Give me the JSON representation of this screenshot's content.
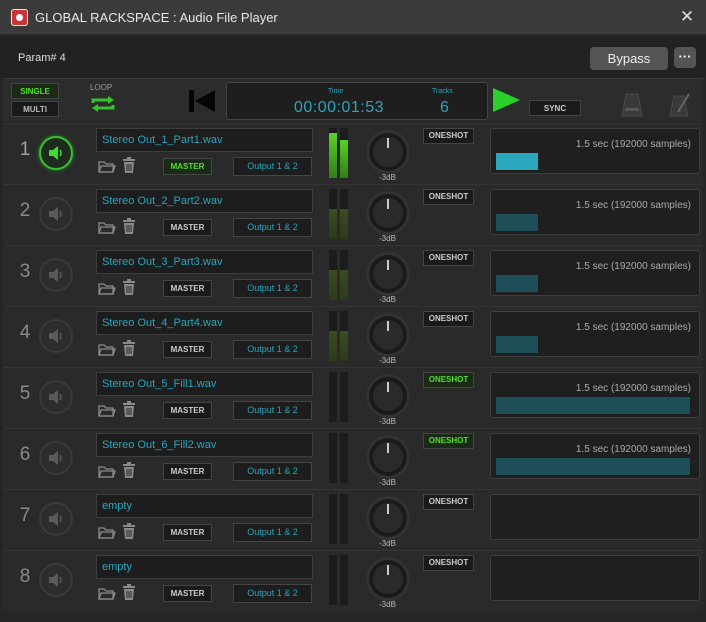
{
  "window": {
    "title": "GLOBAL RACKSPACE : Audio File Player",
    "close_glyph": "✕"
  },
  "topbar": {
    "param": "Param# 4",
    "bypass": "Bypass",
    "more": "···"
  },
  "transport": {
    "single": "SINGLE",
    "multi": "MULTI",
    "loop": "LOOP",
    "time_label": "Time",
    "time": "00:00:01:53",
    "tracks_label": "Tracks",
    "tracks": "6",
    "sync": "SYNC"
  },
  "colors": {
    "accent_teal": "#29a5bd",
    "active_green": "#4ee02b"
  },
  "icons": [
    "app-icon",
    "close-icon",
    "loop-icon",
    "previous-icon",
    "play-icon",
    "metronome-icon",
    "speaker-icon",
    "folder-icon",
    "trash-icon"
  ],
  "rows": [
    {
      "num": "1",
      "file": "Stereo Out_1_Part1.wav",
      "master": "MASTER",
      "output": "Output 1 & 2",
      "db": "-3dB",
      "oneshot": "ONESHOT",
      "wave_text": "1.5 sec (192000 samples)"
    },
    {
      "num": "2",
      "file": "Stereo Out_2_Part2.wav",
      "master": "MASTER",
      "output": "Output 1 & 2",
      "db": "-3dB",
      "oneshot": "ONESHOT",
      "wave_text": "1.5 sec (192000 samples)"
    },
    {
      "num": "3",
      "file": "Stereo Out_3_Part3.wav",
      "master": "MASTER",
      "output": "Output 1 & 2",
      "db": "-3dB",
      "oneshot": "ONESHOT",
      "wave_text": "1.5 sec (192000 samples)"
    },
    {
      "num": "4",
      "file": "Stereo Out_4_Part4.wav",
      "master": "MASTER",
      "output": "Output 1 & 2",
      "db": "-3dB",
      "oneshot": "ONESHOT",
      "wave_text": "1.5 sec (192000 samples)"
    },
    {
      "num": "5",
      "file": "Stereo Out_5_Fill1.wav",
      "master": "MASTER",
      "output": "Output 1 & 2",
      "db": "-3dB",
      "oneshot": "ONESHOT",
      "wave_text": "1.5 sec (192000 samples)"
    },
    {
      "num": "6",
      "file": "Stereo Out_6_Fill2.wav",
      "master": "MASTER",
      "output": "Output 1 & 2",
      "db": "-3dB",
      "oneshot": "ONESHOT",
      "wave_text": "1.5 sec (192000 samples)"
    },
    {
      "num": "7",
      "file": "empty",
      "master": "MASTER",
      "output": "Output 1 & 2",
      "db": "-3dB",
      "oneshot": "ONESHOT",
      "wave_text": ""
    },
    {
      "num": "8",
      "file": "empty",
      "master": "MASTER",
      "output": "Output 1 & 2",
      "db": "-3dB",
      "oneshot": "ONESHOT",
      "wave_text": ""
    }
  ]
}
